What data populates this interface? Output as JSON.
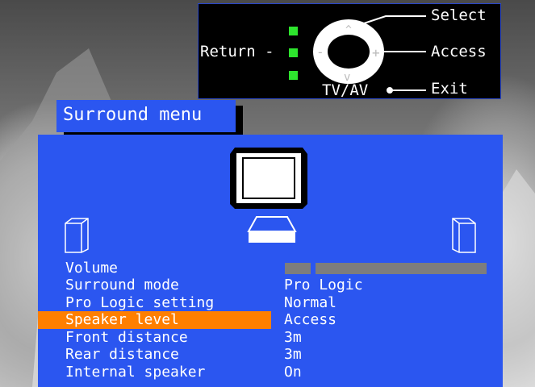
{
  "remote": {
    "return_label": "Return -",
    "select_label": "Select",
    "access_label": "Access",
    "exit_label": "Exit",
    "tvav_label": "TV/AV"
  },
  "menu": {
    "title": "Surround menu",
    "rows": [
      {
        "label": "Volume",
        "value": ""
      },
      {
        "label": "Surround mode",
        "value": "Pro Logic"
      },
      {
        "label": "Pro Logic setting",
        "value": "Normal"
      },
      {
        "label": "Speaker level",
        "value": "Access"
      },
      {
        "label": "Front distance",
        "value": "3m"
      },
      {
        "label": "Rear distance",
        "value": "3m"
      },
      {
        "label": "Internal speaker",
        "value": "On"
      }
    ],
    "selected_row": "Speaker level"
  },
  "colors": {
    "panel_blue": "#2b56f0",
    "highlight_orange": "#ff7f00",
    "indicator_green": "#2ee52e",
    "bar_grey": "#7d7d7d"
  },
  "icons": [
    "remote-dpad-icon",
    "tv-icon",
    "center-speaker-icon",
    "left-speaker-icon",
    "right-speaker-icon",
    "dot-icon"
  ]
}
